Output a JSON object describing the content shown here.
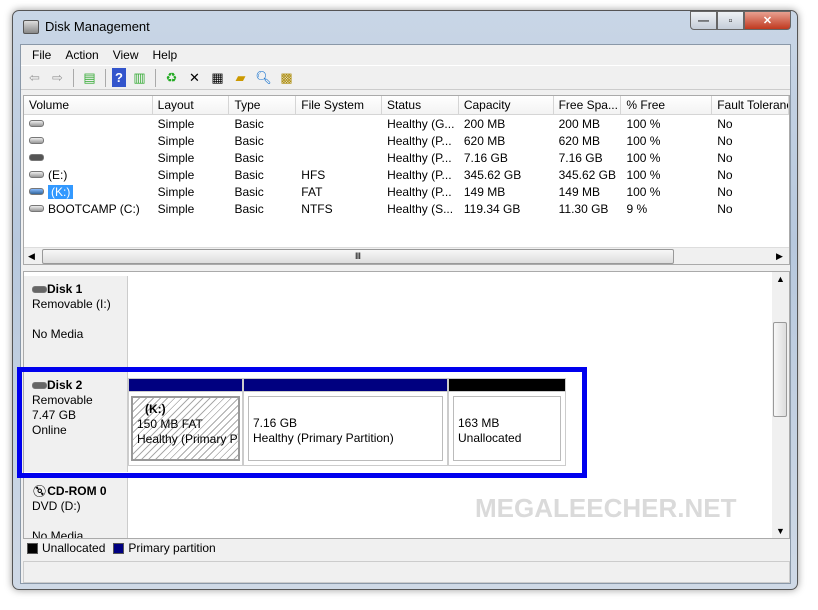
{
  "window": {
    "title": "Disk Management"
  },
  "menu": [
    "File",
    "Action",
    "View",
    "Help"
  ],
  "toolbar": [
    "back-icon",
    "forward-icon",
    "show-hide-console-tree-icon",
    "help-icon",
    "show-hide-action-pane-icon",
    "refresh-icon",
    "delete-icon",
    "properties-icon",
    "open-icon",
    "rescan-icon",
    "settings-icon"
  ],
  "columns": [
    "Volume",
    "Layout",
    "Type",
    "File System",
    "Status",
    "Capacity",
    "Free Spa...",
    "% Free",
    "Fault Toleranc"
  ],
  "rows": [
    [
      "",
      "Simple",
      "Basic",
      "",
      "Healthy (G...",
      "200 MB",
      "200 MB",
      "100 %",
      "No"
    ],
    [
      "",
      "Simple",
      "Basic",
      "",
      "Healthy (P...",
      "620 MB",
      "620 MB",
      "100 %",
      "No"
    ],
    [
      "",
      "Simple",
      "Basic",
      "",
      "Healthy (P...",
      "7.16 GB",
      "7.16 GB",
      "100 %",
      "No"
    ],
    [
      "(E:)",
      "Simple",
      "Basic",
      "HFS",
      "Healthy (P...",
      "345.62 GB",
      "345.62 GB",
      "100 %",
      "No"
    ],
    [
      "(K:)",
      "Simple",
      "Basic",
      "FAT",
      "Healthy (P...",
      "149 MB",
      "149 MB",
      "100 %",
      "No"
    ],
    [
      "BOOTCAMP (C:)",
      "Simple",
      "Basic",
      "NTFS",
      "Healthy (S...",
      "119.34 GB",
      "11.30 GB",
      "9 %",
      "No"
    ]
  ],
  "selected_row": 4,
  "disks": {
    "disk1": {
      "name": "Disk 1",
      "type": "Removable (I:)",
      "status": "No Media"
    },
    "disk2": {
      "name": "Disk 2",
      "type": "Removable",
      "size": "7.47 GB",
      "status": "Online",
      "partitions": [
        {
          "label": "(K:)",
          "size": "150 MB FAT",
          "status": "Healthy (Primary P"
        },
        {
          "size": "7.16 GB",
          "status": "Healthy (Primary Partition)"
        },
        {
          "size": "163 MB",
          "status": "Unallocated"
        }
      ]
    },
    "cdrom0": {
      "name": "CD-ROM 0",
      "type": "DVD (D:)",
      "status": "No Media"
    }
  },
  "legend": {
    "unallocated": "Unallocated",
    "primary": "Primary partition"
  },
  "colors": {
    "primary": "#000080",
    "unallocated": "#000000",
    "highlight": "#0000ee",
    "selection": "#3399ff"
  },
  "watermark": "MEGALEECHER.NET"
}
